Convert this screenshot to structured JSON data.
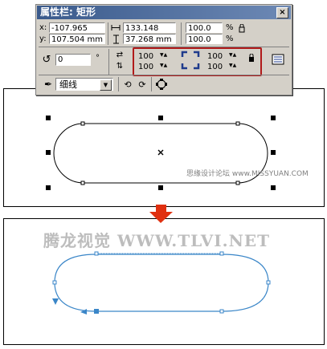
{
  "property_bar": {
    "title": "属性栏: 矩形",
    "close_glyph": "×",
    "x_label": "x:",
    "x_value": "-107.965 mm",
    "y_label": "y:",
    "y_value": "107.504 mm",
    "width_value": "133.148 mm",
    "height_value": "37.268 mm",
    "scale_x": "100.0",
    "scale_y": "100.0",
    "percent": "%",
    "rotation_value": "0",
    "degree_symbol": "°",
    "corner_top_left": "100",
    "corner_top_right": "100",
    "corner_bottom_left": "100",
    "corner_bottom_right": "100",
    "outline_width": "细线"
  },
  "top_canvas": {
    "watermark": "思缘设计论坛 www.MISSYUAN.COM"
  },
  "bottom_canvas": {
    "watermark": "腾龙视觉 WWW.TLVI.NET"
  },
  "colors": {
    "highlight_box": "#b11a1a",
    "arrow": "#e03010",
    "curve": "#3a86c8",
    "toolbar_bg": "#d4d0c8",
    "titlebar": "#3a5a8c"
  }
}
